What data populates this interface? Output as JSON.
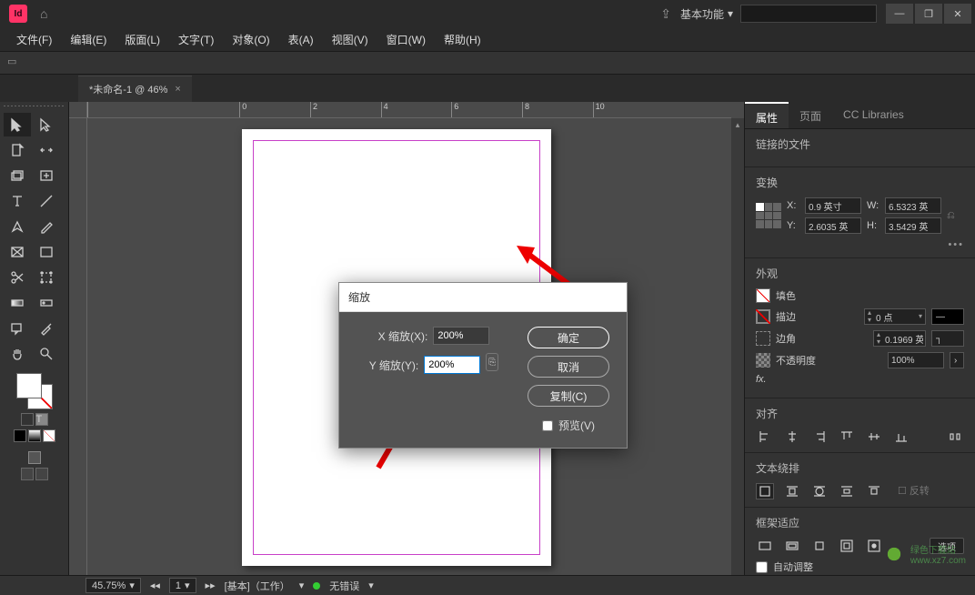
{
  "titlebar": {
    "app_abbrev": "Id",
    "workspace": "基本功能",
    "search_placeholder": "",
    "win_min": "—",
    "win_max": "❐",
    "win_close": "✕"
  },
  "menu": {
    "items": [
      "文件(F)",
      "编辑(E)",
      "版面(L)",
      "文字(T)",
      "对象(O)",
      "表(A)",
      "视图(V)",
      "窗口(W)",
      "帮助(H)"
    ]
  },
  "tab": {
    "title": "*未命名-1 @ 46%",
    "close": "×"
  },
  "ruler": {
    "ticks": [
      "0",
      "2",
      "4",
      "6",
      "8",
      "10"
    ]
  },
  "dialog": {
    "title": "缩放",
    "x_label": "X 缩放(X):",
    "x_value": "200%",
    "y_label": "Y 缩放(Y):",
    "y_value": "200%",
    "ok": "确定",
    "cancel": "取消",
    "copy": "复制(C)",
    "preview": "预览(V)"
  },
  "panels": {
    "tabs": {
      "properties": "属性",
      "pages": "页面",
      "cc": "CC Libraries"
    },
    "linked_header": "链接的文件",
    "transform": {
      "title": "变换",
      "x_label": "X:",
      "x_value": "0.9 英寸",
      "w_label": "W:",
      "w_value": "6.5323 英",
      "y_label": "Y:",
      "y_value": "2.6035 英",
      "h_label": "H:",
      "h_value": "3.5429 英",
      "more": "•••"
    },
    "appearance": {
      "title": "外观",
      "fill": "填色",
      "stroke": "描边",
      "stroke_value": "0 点",
      "corner": "边角",
      "corner_value": "0.1969 英",
      "opacity": "不透明度",
      "opacity_value": "100%",
      "fx": "fx."
    },
    "align": {
      "title": "对齐"
    },
    "wrap": {
      "title": "文本绕排",
      "invert": "反转"
    },
    "fit": {
      "title": "框架适应",
      "options": "选项",
      "auto": "自动调整"
    }
  },
  "status": {
    "zoom": "45.75%",
    "page": "1",
    "profile": "[基本]（工作）",
    "errors": "无错误"
  }
}
